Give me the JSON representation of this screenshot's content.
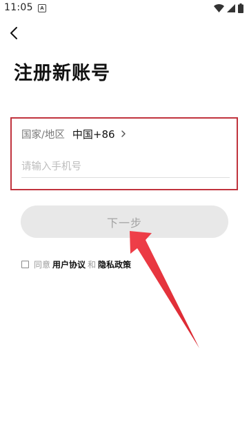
{
  "status_bar": {
    "time": "11:05",
    "app_icon_letter": "A"
  },
  "page": {
    "title": "注册新账号"
  },
  "form": {
    "region_label": "国家/地区",
    "region_value": "中国+86",
    "phone_placeholder": "请输入手机号",
    "phone_value": ""
  },
  "next_button": {
    "label": "下一步",
    "enabled": false
  },
  "agreement": {
    "checked": false,
    "prefix": "同意",
    "user_agreement": "用户协议",
    "conjunction": "和",
    "privacy_policy": "隐私政策"
  },
  "colors": {
    "highlight_box": "#c0323c",
    "arrow": "#e3303b",
    "button_bg": "#e8e8e8",
    "button_text": "#a3a3a3"
  }
}
